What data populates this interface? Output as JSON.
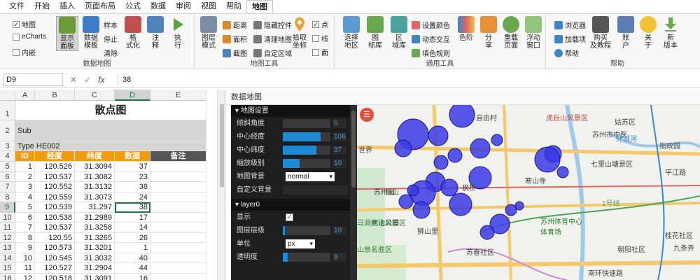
{
  "menubar": {
    "items": [
      "文件",
      "开始",
      "插入",
      "页面布局",
      "公式",
      "数据",
      "审阅",
      "视图",
      "帮助",
      "地图"
    ],
    "active": "地图"
  },
  "ribbon": {
    "groups": {
      "map_data_label": "数据地图",
      "map_tools_label": "地图工具",
      "general_tools_label": "通用工具",
      "help_label": "帮助"
    },
    "checkboxes": [
      {
        "label": "地图",
        "checked": true
      },
      {
        "label": "eCharts",
        "checked": false
      },
      {
        "label": "内嵌",
        "checked": false
      }
    ],
    "buttons": {
      "show_panel": "显示\n面板",
      "data_template": "数据\n模板",
      "sample": "样本",
      "stop": "停止",
      "clear": "清除",
      "format": "格\n式化",
      "annotate": "注\n释",
      "execute": "执\n行",
      "layer_mode": "图层\n模式",
      "distance": "距离",
      "area": "面积",
      "screenshot": "截图",
      "hide_control": "隐藏控件",
      "clear_map": "清理地图",
      "custom_region": "自定区域",
      "pick_coord": "拾取\n坐标",
      "point": "点",
      "line": "线",
      "polygon": "面",
      "select_region": "选择\n地区",
      "marker_lib": "图\n标库",
      "region_lib": "区\n域库",
      "set_color": "设置颜色",
      "dynamic_interact": "动态交互",
      "fill_rule": "填色规则",
      "palette": "色阶",
      "share": "分\n享",
      "reload": "重载\n页面",
      "float_window": "浮动\n窗口",
      "browser": "浏览器",
      "load_item": "加载项",
      "help": "帮助",
      "buy": "购买\n及教程",
      "account": "账\n户",
      "about": "关\n于",
      "new_version": "新\n版本"
    },
    "checkbox_point": true,
    "checkbox_line": false,
    "checkbox_polygon": false
  },
  "formula_bar": {
    "cell_ref": "D9",
    "value": "38"
  },
  "sheet": {
    "columns": [
      "A",
      "B",
      "C",
      "D",
      "E"
    ],
    "selected_column": "D",
    "selected_row": 9,
    "title": "散点图",
    "sub_label": "Sub",
    "type_label": "Type HE002",
    "header": [
      "ID",
      "经度",
      "纬度",
      "数据",
      "备注"
    ],
    "rows": [
      {
        "id": "1",
        "lng": "120.526",
        "lat": "31.3094",
        "val": "37"
      },
      {
        "id": "2",
        "lng": "120.537",
        "lat": "31.3082",
        "val": "23"
      },
      {
        "id": "3",
        "lng": "120.552",
        "lat": "31.3132",
        "val": "38"
      },
      {
        "id": "4",
        "lng": "120.559",
        "lat": "31.3073",
        "val": "24"
      },
      {
        "id": "5",
        "lng": "120.539",
        "lat": "31.297",
        "val": "38"
      },
      {
        "id": "6",
        "lng": "120.538",
        "lat": "31.2989",
        "val": "17"
      },
      {
        "id": "7",
        "lng": "120.537",
        "lat": "31.3258",
        "val": "14"
      },
      {
        "id": "8",
        "lng": "120.55",
        "lat": "31.3265",
        "val": "26"
      },
      {
        "id": "9",
        "lng": "120.573",
        "lat": "31.3201",
        "val": "1"
      },
      {
        "id": "10",
        "lng": "120.545",
        "lat": "31.3032",
        "val": "40"
      },
      {
        "id": "11",
        "lng": "120.527",
        "lat": "31.2904",
        "val": "44"
      },
      {
        "id": "12",
        "lng": "120.518",
        "lat": "31.3091",
        "val": "16"
      }
    ]
  },
  "map_panel": {
    "title": "数据地图",
    "menu_icon": "menu-icon",
    "settings_section": "地图设置",
    "settings": [
      {
        "label": "倾斜角度",
        "value": "0",
        "fill": 0.0
      },
      {
        "label": "中心经度",
        "value": "106",
        "fill": 0.8
      },
      {
        "label": "中心纬度",
        "value": "37",
        "fill": 0.7
      },
      {
        "label": "缩放级别",
        "value": "10",
        "fill": 0.35
      }
    ],
    "background_label": "地图背景",
    "background_value": "normal",
    "custom_bg_label": "自定义背景",
    "layer_section": "layer0",
    "show_label": "显示",
    "show_checked": true,
    "layer_level_label": "图层层级",
    "layer_level_value": "10",
    "layer_level_fill": 0.05,
    "unit_label": "单位",
    "unit_value": "px",
    "opacity_label": "透明度",
    "opacity_value": "8",
    "map_labels": [
      "虎丘山风景区",
      "姑苏区",
      "苏州市中医",
      "拙政园",
      "七里山塘景区",
      "平江路",
      "寒山寺",
      "苏州体育中心\n体育场",
      "狮山",
      "枫桥",
      "何山公园",
      "马涧龙池风景区",
      "山景名胜区",
      "桂花社区",
      "九条弄",
      "南环快速路",
      "外城河",
      "1号线",
      "自由村",
      "世界",
      "狮山里",
      "苏春社区",
      "朝阳社区",
      "苏州园"
    ]
  }
}
